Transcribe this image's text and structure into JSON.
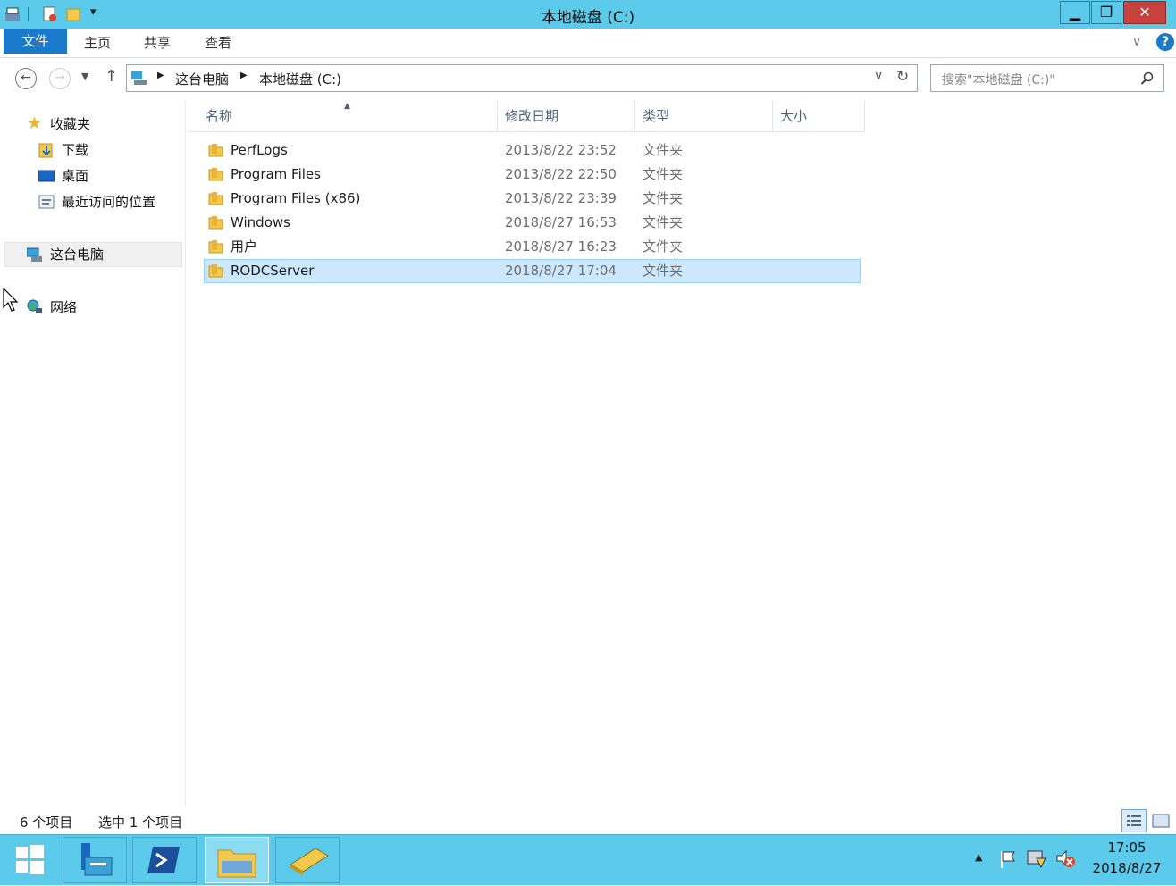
{
  "window": {
    "title": "本地磁盘 (C:)"
  },
  "ribbon": {
    "tabs": [
      "文件",
      "主页",
      "共享",
      "查看"
    ]
  },
  "address": {
    "crumbs": [
      "这台电脑",
      "本地磁盘 (C:)"
    ],
    "search_placeholder": "搜索\"本地磁盘 (C:)\""
  },
  "nav": {
    "favorites": "收藏夹",
    "downloads": "下载",
    "desktop": "桌面",
    "recent": "最近访问的位置",
    "this_pc": "这台电脑",
    "network": "网络"
  },
  "columns": {
    "name": "名称",
    "modified": "修改日期",
    "type": "类型",
    "size": "大小"
  },
  "files": [
    {
      "name": "PerfLogs",
      "modified": "2013/8/22 23:52",
      "type": "文件夹"
    },
    {
      "name": "Program Files",
      "modified": "2013/8/22 22:50",
      "type": "文件夹"
    },
    {
      "name": "Program Files (x86)",
      "modified": "2013/8/22 23:39",
      "type": "文件夹"
    },
    {
      "name": "Windows",
      "modified": "2018/8/27 16:53",
      "type": "文件夹"
    },
    {
      "name": "用户",
      "modified": "2018/8/27 16:23",
      "type": "文件夹"
    },
    {
      "name": "RODCServer",
      "modified": "2018/8/27 17:04",
      "type": "文件夹"
    }
  ],
  "status": {
    "count": "6 个项目",
    "selected": "选中 1 个项目"
  },
  "taskbar": {
    "time": "17:05",
    "date": "2018/8/27"
  },
  "colors": {
    "titlebar": "#5ccaeb",
    "file_tab": "#1979ca",
    "selection": "#cce8ff",
    "close": "#c7423c"
  }
}
